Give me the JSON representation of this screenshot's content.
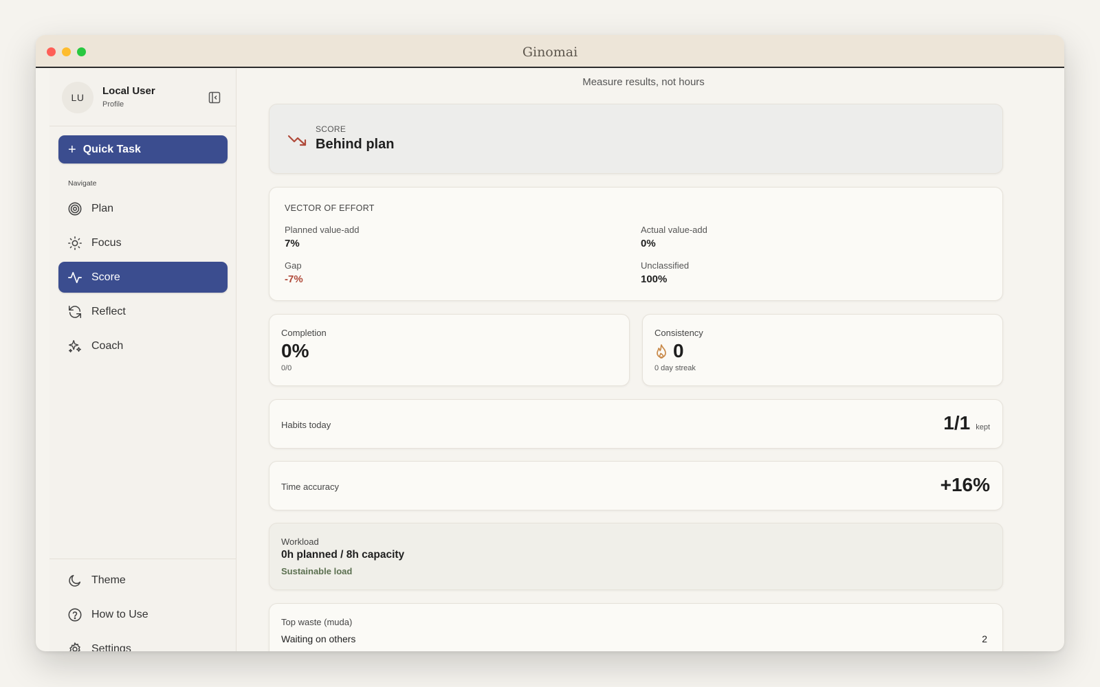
{
  "window": {
    "title": "Ginomai"
  },
  "profile": {
    "initials": "LU",
    "name": "Local User",
    "subtitle": "Profile",
    "collapse_icon": "panel-collapse-icon"
  },
  "sidebar": {
    "quick_task_label": "Quick Task",
    "nav_heading": "Navigate",
    "items": [
      {
        "label": "Plan",
        "icon": "target-icon",
        "active": false
      },
      {
        "label": "Focus",
        "icon": "sun-icon",
        "active": false
      },
      {
        "label": "Score",
        "icon": "activity-icon",
        "active": true
      },
      {
        "label": "Reflect",
        "icon": "refresh-icon",
        "active": false
      },
      {
        "label": "Coach",
        "icon": "sparkles-icon",
        "active": false
      }
    ],
    "bottom_items": [
      {
        "label": "Theme",
        "icon": "moon-icon"
      },
      {
        "label": "How to Use",
        "icon": "help-circle-icon"
      },
      {
        "label": "Settings",
        "icon": "gear-icon"
      }
    ]
  },
  "main": {
    "subtitle": "Measure results, not hours",
    "score": {
      "label": "SCORE",
      "value": "Behind plan",
      "icon": "trending-down-icon"
    },
    "vector": {
      "title": "VECTOR OF EFFORT",
      "planned_label": "Planned value-add",
      "planned_value": "7%",
      "actual_label": "Actual value-add",
      "actual_value": "0%",
      "gap_label": "Gap",
      "gap_value": "-7%",
      "unclassified_label": "Unclassified",
      "unclassified_value": "100%"
    },
    "completion": {
      "label": "Completion",
      "value": "0%",
      "detail": "0/0"
    },
    "consistency": {
      "label": "Consistency",
      "value": "0",
      "detail": "0 day streak",
      "icon": "flame-icon"
    },
    "habits": {
      "label": "Habits today",
      "value": "1/1",
      "unit": "kept"
    },
    "time_accuracy": {
      "label": "Time accuracy",
      "value": "+16%"
    },
    "workload": {
      "label": "Workload",
      "value": "0h planned / 8h capacity",
      "status": "Sustainable load"
    },
    "waste": {
      "label": "Top waste (muda)",
      "item": "Waiting on others",
      "count": "2"
    }
  },
  "colors": {
    "accent": "#3b4d8f",
    "negative": "#b04a3a",
    "positive": "#5b7050",
    "flame": "#c98a4a"
  }
}
